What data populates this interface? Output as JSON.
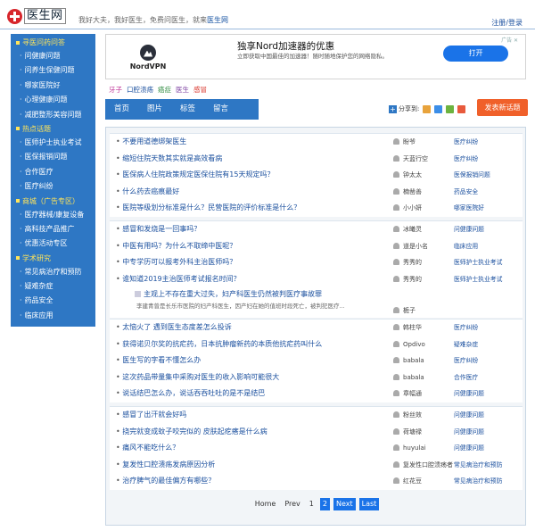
{
  "header": {
    "logo_text": "医生网",
    "tagline_prefix": "我好大夫，我好医生，免费问医生，就来",
    "tagline_site": "医生网",
    "login": "注册/登录"
  },
  "sidebar": {
    "sections": [
      {
        "title": "寻医问药问答",
        "items": [
          "问健康问题",
          "问养生保健问题",
          "哪家医院好",
          "心理健康问题",
          "减肥整形美容问题"
        ]
      },
      {
        "title": "热点话题",
        "items": [
          "医师护士执业考试",
          "医保报销问题",
          "合作医疗",
          "医疗纠纷"
        ]
      },
      {
        "title": "商城（广告专区）",
        "items": [
          "医疗器械/康复设备",
          "高科技产品推广",
          "优惠活动专区"
        ]
      },
      {
        "title": "学术研究",
        "items": [
          "常见病治疗和预防",
          "疑难杂症",
          "药品安全",
          "临床应用"
        ]
      }
    ]
  },
  "ad": {
    "brand": "NordVPN",
    "title": "独享Nord加速器的优惠",
    "desc": "立即获取中国最佳的加速器！随时随地保护您的网络隐私。",
    "button": "打开",
    "mark": "广告 ✕"
  },
  "tags": [
    {
      "label": "牙子",
      "color": "#c0399a"
    },
    {
      "label": "口腔溃疡",
      "color": "#1a4f9e"
    },
    {
      "label": "癌症",
      "color": "#2b8a3e"
    },
    {
      "label": "医生",
      "color": "#7b3fa0"
    },
    {
      "label": "感冒",
      "color": "#d9342b"
    }
  ],
  "tabs": [
    "首页",
    "图片",
    "标签",
    "留言"
  ],
  "share": {
    "label": "分享到:",
    "colors": [
      "#e8a33c",
      "#3c8ee8",
      "#6cb33f",
      "#e85a3c"
    ]
  },
  "new_topic": "发表新话题",
  "groups": [
    [
      {
        "title": "不要用道德绑架医生",
        "user": "盼爷",
        "cat": "医疗纠纷"
      },
      {
        "title": "缩短住院天数其实就是高效看病",
        "user": "天蓝行空",
        "cat": "医疗纠纷"
      },
      {
        "title": "医保病人住院政策规定医保住院有15天规定吗？",
        "user": "钟太太",
        "cat": "医保报销问题"
      },
      {
        "title": "什么药去癌痕最好",
        "user": "楠凿善",
        "cat": "药品安全"
      },
      {
        "title": "医院等级划分标准是什么？民营医院的评价标准是什么？",
        "user": "小小妍",
        "cat": "哪家医院好"
      }
    ],
    [
      {
        "title": "感冒和发烧是一回事吗？",
        "user": "冰曦灵",
        "cat": "问健康问题"
      },
      {
        "title": "中医有用吗？为什么不取缔中医呢？",
        "user": "道是小名",
        "cat": "临床应用"
      },
      {
        "title": "中专学历可以报考外科主治医师吗？",
        "user": "秀秀的",
        "cat": "医师护士执业考试"
      },
      {
        "title": "谁知道2019主治医师考试报名时间？",
        "user": "秀秀的",
        "cat": "医师护士执业考试"
      }
    ],
    [
      {
        "title": "太恼火了 遇到医生态度差怎么投诉",
        "user": "韩柱华",
        "cat": "医疗纠纷"
      },
      {
        "title": "获得诺贝尔奖的抗疟药，日本抗肿瘤新药的本质他抗疟药叫什么",
        "user": "Opdivo",
        "cat": "疑难杂症"
      },
      {
        "title": "医生写的字看不懂怎么办",
        "user": "babala",
        "cat": "医疗纠纷"
      },
      {
        "title": "这次药品带量集中采购对医生的收入影响可能很大",
        "user": "babala",
        "cat": "合作医疗"
      },
      {
        "title": "说话结巴怎么办，说话吞吞吐吐的是不是结巴",
        "user": "章幅通",
        "cat": "问健康问题"
      }
    ],
    [
      {
        "title": "感冒了出汗就会好吗",
        "user": "粉丝效",
        "cat": "问健康问题"
      },
      {
        "title": "挠完就变成蚊子咬完似的 皮肤起疙瘩是什么病",
        "user": "荷塘禄",
        "cat": "问健康问题"
      },
      {
        "title": "痛风不能吃什么？",
        "user": "huyulai",
        "cat": "问健康问题"
      },
      {
        "title": "复发性口腔溃疡发病原因分析",
        "user": "复发性口腔溃疡者",
        "cat": "常见病治疗和预防"
      },
      {
        "title": "治疗脾气的最佳偏方有哪些？",
        "user": "红花豆",
        "cat": "常见病治疗和预防"
      }
    ]
  ],
  "featured": {
    "title": "主观上不存在重大过失，妇产科医生仍然被判医疗事故罪",
    "desc": "李建青曾是长乐市医院的妇产科医生，因产妇在她的值班时段死亡，被判犯医疗...",
    "user": "栀子"
  },
  "pager": {
    "home": "Home",
    "prev": "Prev",
    "page1": "1",
    "page2": "2",
    "next": "Next",
    "last": "Last"
  }
}
